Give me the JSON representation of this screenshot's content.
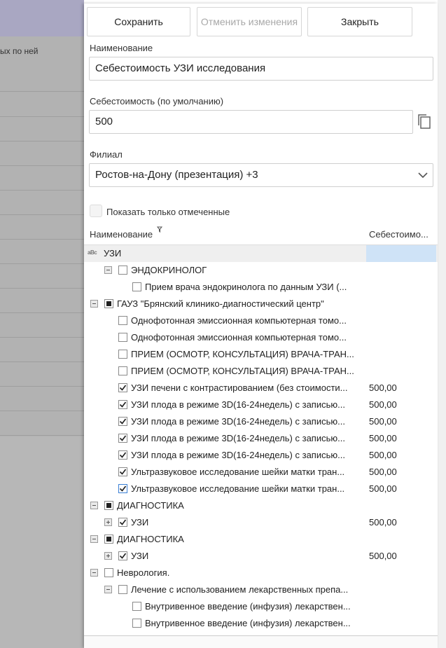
{
  "background": {
    "visible_text": "ых по ней"
  },
  "toolbar": {
    "save_label": "Сохранить",
    "discard_label": "Отменить изменения",
    "close_label": "Закрыть"
  },
  "form": {
    "name_label": "Наименование",
    "name_value": "Себестоимость УЗИ исследования",
    "cost_label": "Себестоимость (по умолчанию)",
    "cost_value": "500",
    "branch_label": "Филиал",
    "branch_value": "Ростов-на-Дону (презентация) +3",
    "show_checked_label": "Показать только отмеченные"
  },
  "table": {
    "headers": {
      "name": "Наименование",
      "cost": "Себестоимо..."
    },
    "rows": [
      {
        "text": "УЗИ",
        "value": "",
        "level": 0,
        "kind": "root",
        "checkbox": "none",
        "expander": "none"
      },
      {
        "text": "ЭНДОКРИНОЛОГ",
        "value": "",
        "level": 1,
        "checkbox": "empty",
        "expander": "minus"
      },
      {
        "text": "Прием врача эндокринолога по данным УЗИ (...",
        "value": "",
        "level": 2,
        "checkbox": "empty",
        "expander": "none"
      },
      {
        "text": "ГАУЗ \"Брянский клинико-диагностический центр\"",
        "value": "",
        "level": 0,
        "checkbox": "partial",
        "expander": "minus"
      },
      {
        "text": "Однофотонная эмиссионная компьютерная томо...",
        "value": "",
        "level": 1,
        "checkbox": "empty",
        "expander": "none"
      },
      {
        "text": "Однофотонная эмиссионная компьютерная томо...",
        "value": "",
        "level": 1,
        "checkbox": "empty",
        "expander": "none"
      },
      {
        "text": "ПРИЕМ (ОСМОТР, КОНСУЛЬТАЦИЯ) ВРАЧА-ТРАН...",
        "value": "",
        "level": 1,
        "checkbox": "empty",
        "expander": "none"
      },
      {
        "text": "ПРИЕМ (ОСМОТР, КОНСУЛЬТАЦИЯ) ВРАЧА-ТРАН...",
        "value": "",
        "level": 1,
        "checkbox": "empty",
        "expander": "none"
      },
      {
        "text": "УЗИ печени с контрастированием (без стоимости...",
        "value": "500,00",
        "level": 1,
        "checkbox": "checked",
        "expander": "none"
      },
      {
        "text": "УЗИ плода в режиме 3D(16-24недель) с записью...",
        "value": "500,00",
        "level": 1,
        "checkbox": "checked",
        "expander": "none"
      },
      {
        "text": "УЗИ плода в режиме 3D(16-24недель) с записью...",
        "value": "500,00",
        "level": 1,
        "checkbox": "checked",
        "expander": "none"
      },
      {
        "text": "УЗИ плода в режиме 3D(16-24недель) с записью...",
        "value": "500,00",
        "level": 1,
        "checkbox": "checked",
        "expander": "none"
      },
      {
        "text": "УЗИ плода в режиме 3D(16-24недель) с записью...",
        "value": "500,00",
        "level": 1,
        "checkbox": "checked",
        "expander": "none"
      },
      {
        "text": "Ультразвуковое исследование шейки матки тран...",
        "value": "500,00",
        "level": 1,
        "checkbox": "checked",
        "expander": "none"
      },
      {
        "text": "Ультразвуковое исследование шейки матки тран...",
        "value": "500,00",
        "level": 1,
        "checkbox": "checked-blue",
        "expander": "none"
      },
      {
        "text": "ДИАГНОСТИКА",
        "value": "",
        "level": 0,
        "checkbox": "partial",
        "expander": "minus"
      },
      {
        "text": "УЗИ",
        "value": "500,00",
        "level": 1,
        "checkbox": "checked",
        "expander": "plus"
      },
      {
        "text": "ДИАГНОСТИКА",
        "value": "",
        "level": 0,
        "checkbox": "partial",
        "expander": "minus"
      },
      {
        "text": "УЗИ",
        "value": "500,00",
        "level": 1,
        "checkbox": "checked",
        "expander": "plus"
      },
      {
        "text": "Неврология.",
        "value": "",
        "level": 0,
        "checkbox": "empty",
        "expander": "minus"
      },
      {
        "text": "Лечение с использованием лекарственных препа...",
        "value": "",
        "level": 1,
        "checkbox": "empty",
        "expander": "minus"
      },
      {
        "text": "Внутривенное введение (инфузия) лекарствен...",
        "value": "",
        "level": 2,
        "checkbox": "empty",
        "expander": "none"
      },
      {
        "text": "Внутривенное введение (инфузия) лекарствен...",
        "value": "",
        "level": 2,
        "checkbox": "empty",
        "expander": "none"
      }
    ]
  },
  "colors": {
    "selection": "#cfe3f7",
    "group_bg": "#efefef",
    "checkbox_blue": "#3a7fd5",
    "overlay_bg": "#b2b2b2"
  },
  "icons": [
    "copy-icon",
    "chevron-down-icon",
    "filter-icon",
    "abc-icon",
    "check-icon"
  ]
}
